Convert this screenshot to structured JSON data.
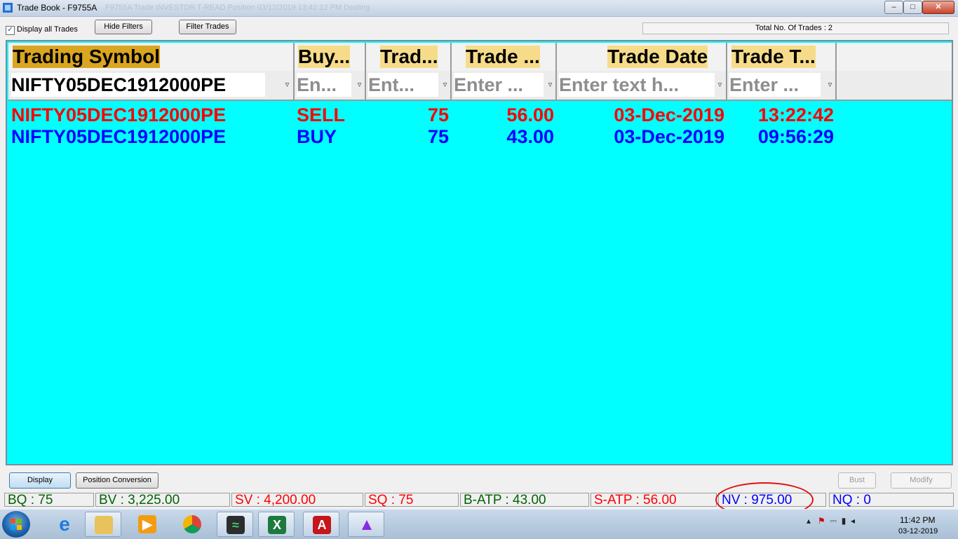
{
  "window": {
    "title": "Trade Book - F9755A",
    "ghost_text": "F9755A   Trade INVESTOR   T-READ   Position   03/12/2019   13:42:12 PM   Dealing"
  },
  "toolbar": {
    "display_all_label": "Display all Trades",
    "display_all_checked": true,
    "hide_filters_label": "Hide Filters",
    "filter_trades_label": "Filter Trades",
    "total_trades_label": "Total No. Of Trades : 2"
  },
  "grid": {
    "columns": [
      "Trading Symbol",
      "Buy...",
      "Trad...",
      "Trade ...",
      "Trade Date",
      "Trade T..."
    ],
    "filters": [
      {
        "value": "NIFTY05DEC1912000PE",
        "is_placeholder": false
      },
      {
        "value": "En...",
        "is_placeholder": true
      },
      {
        "value": "Ent...",
        "is_placeholder": true
      },
      {
        "value": "Enter ...",
        "is_placeholder": true
      },
      {
        "value": "Enter text h...",
        "is_placeholder": true
      },
      {
        "value": "Enter ...",
        "is_placeholder": true
      }
    ],
    "rows": [
      {
        "symbol": "NIFTY05DEC1912000PE",
        "side": "SELL",
        "qty": "75",
        "price": "56.00",
        "date": "03-Dec-2019",
        "time": "13:22:42",
        "color": "#ff0000"
      },
      {
        "symbol": "NIFTY05DEC1912000PE",
        "side": "BUY",
        "qty": "75",
        "price": "43.00",
        "date": "03-Dec-2019",
        "time": "09:56:29",
        "color": "#0000ff"
      }
    ],
    "background": "#00ffff"
  },
  "actions": {
    "display_label": "Display",
    "position_conversion_label": "Position Conversion",
    "bust_label": "Bust",
    "modify_label": "Modify"
  },
  "status": {
    "bq": "BQ : 75",
    "bv": "BV : 3,225.00",
    "sv": "SV : 4,200.00",
    "sq": "SQ : 75",
    "b_atp": "B-ATP : 43.00",
    "s_atp": "S-ATP : 56.00",
    "nv": "NV : 975.00",
    "nq": "NQ : 0",
    "colors": {
      "buy": "#006400",
      "sell": "#ff0000",
      "net": "#0000ff"
    }
  },
  "taskbar": {
    "apps": [
      "internet-explorer-icon",
      "file-explorer-icon",
      "media-player-icon",
      "chrome-icon",
      "trading-terminal-icon",
      "excel-icon",
      "pdf-reader-icon",
      "triangle-app-icon"
    ],
    "time": "11:42 PM",
    "date": "03-12-2019"
  }
}
